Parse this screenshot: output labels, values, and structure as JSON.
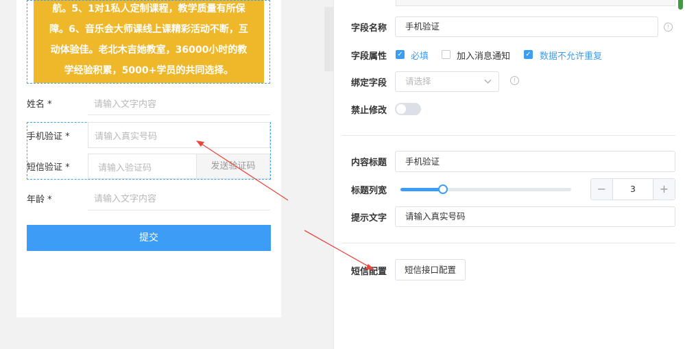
{
  "preview": {
    "banner_lines": [
      "航。5、1对1私人定制课程，教学质量有所保",
      "障。6、音乐会大师课线上课精彩活动不断，互",
      "动体验佳。老北木吉她教室，36000小时的教",
      "学经验积累，5000+学员的共同选择。"
    ],
    "fields": {
      "name_label": "姓名 *",
      "name_placeholder": "请输入文字内容",
      "phone_label": "手机验证 *",
      "phone_placeholder": "请输入真实号码",
      "sms_label": "短信验证 *",
      "sms_placeholder": "请输入验证码",
      "sms_button": "发送验证码",
      "age_label": "年龄 *",
      "age_placeholder": "请输入文字内容"
    },
    "submit_label": "提交"
  },
  "panel": {
    "field_name_label": "字段名称",
    "field_name_value": "手机验证",
    "field_attr_label": "字段属性",
    "checkboxes": [
      {
        "label": "必填",
        "checked": true
      },
      {
        "label": "加入消息通知",
        "checked": false
      },
      {
        "label": "数据不允许重复",
        "checked": true
      }
    ],
    "bind_label": "绑定字段",
    "bind_placeholder": "请选择",
    "disable_edit_label": "禁止修改",
    "disable_edit_on": false,
    "content_title_label": "内容标题",
    "content_title_value": "手机验证",
    "title_cols_label": "标题列宽",
    "title_cols_slider_fraction": 0.25,
    "title_cols_value": "3",
    "hint_label": "提示文字",
    "hint_value": "请输入真实号码",
    "sms_config_label": "短信配置",
    "sms_config_button": "短信接口配置"
  },
  "colors": {
    "accent": "#3d9cf6",
    "banner": "#efb82a",
    "annotation_arrow": "#e8473c"
  },
  "icons": {
    "info": "info-circle-icon",
    "dropdown": "chevron-down-icon",
    "check": "check-icon"
  }
}
